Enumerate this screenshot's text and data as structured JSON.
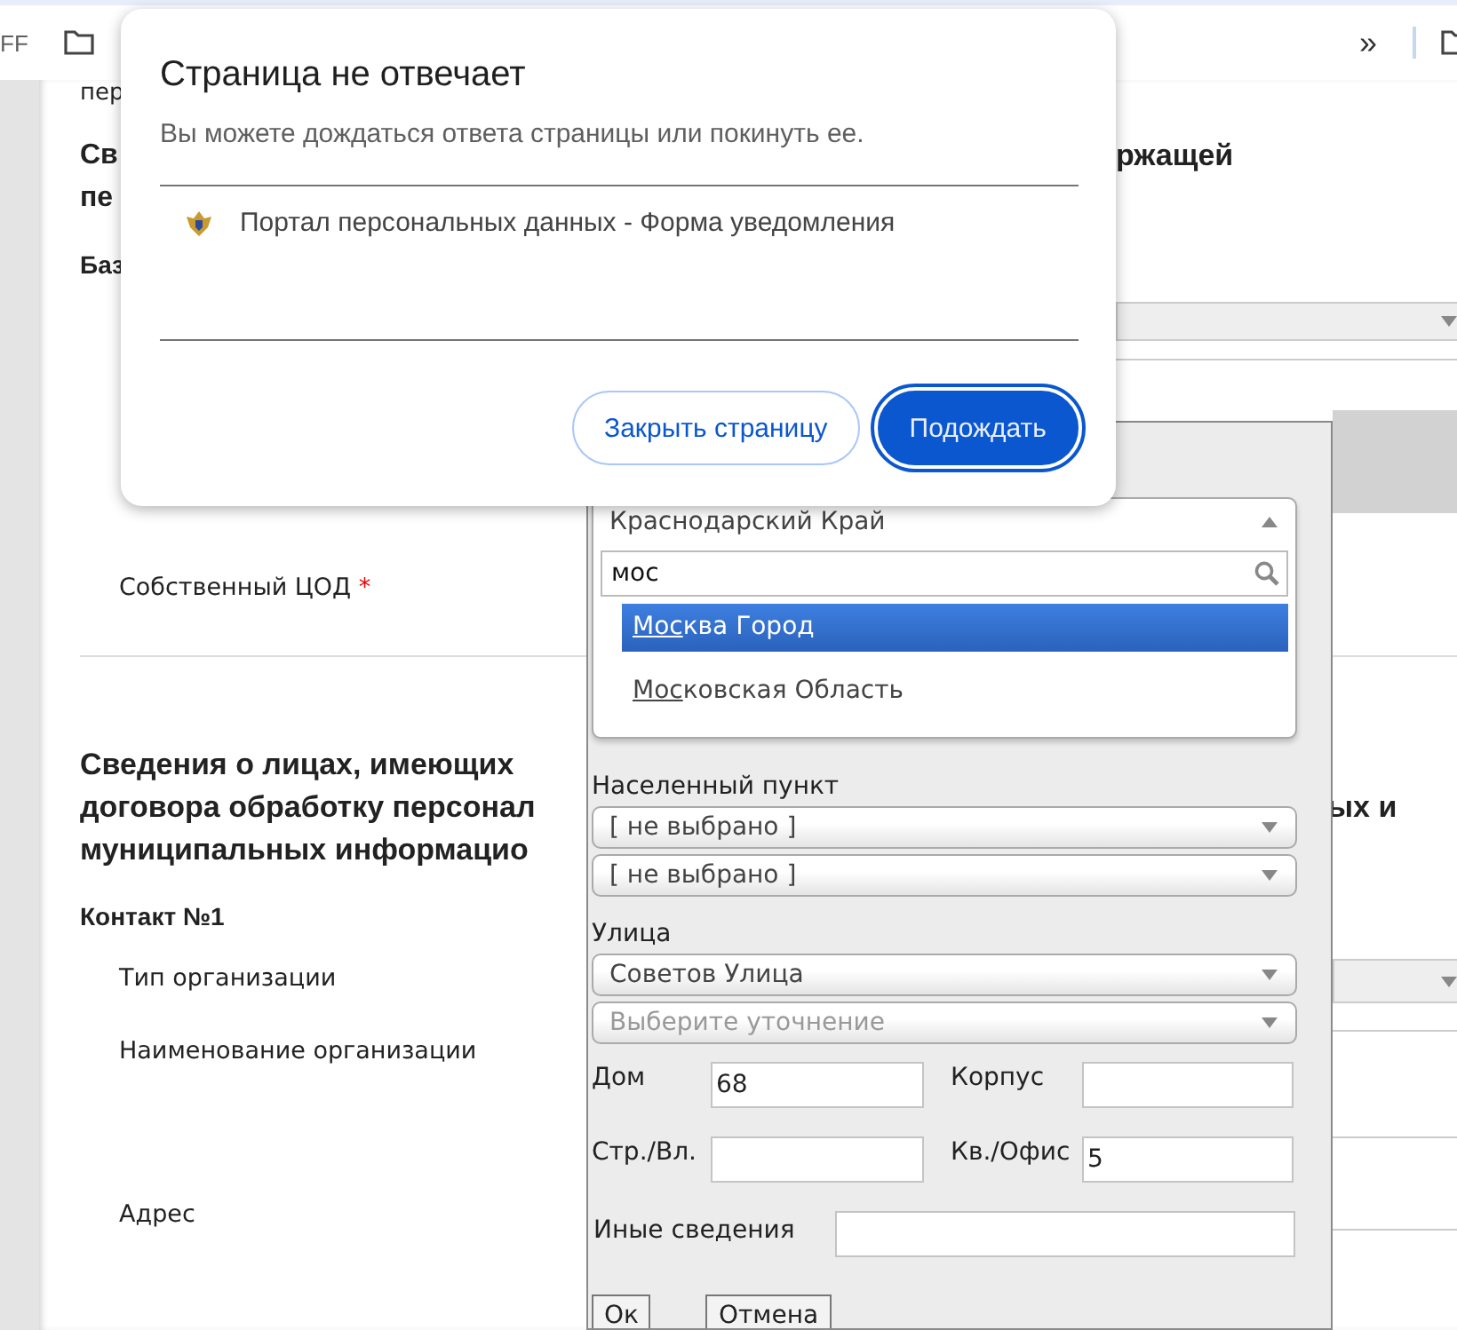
{
  "bookmarks_bar": {
    "items": [
      {
        "label": "FF"
      }
    ],
    "overflow": "»"
  },
  "page": {
    "top_fragment": "пер",
    "heading_1": [
      {
        "left": "Св",
        "right": "ржащей"
      },
      {
        "left": "пе"
      }
    ],
    "subheading": "Баз",
    "own_dc": {
      "label": "Собственный ЦОД",
      "required_mark": "*"
    },
    "heading_2": [
      {
        "left": "Сведения о лицах, имеющих"
      },
      {
        "left": "договора обработку персонал",
        "right": "ых и"
      },
      {
        "left": "муниципальных информацио"
      }
    ],
    "contact": {
      "title": "Контакт №1",
      "fields": [
        {
          "label": "Тип организации",
          "kind": "select"
        },
        {
          "label": "Наименование организации",
          "kind": "text"
        },
        {
          "label": "Адрес",
          "kind": "address"
        }
      ]
    }
  },
  "address_dialog": {
    "region": {
      "value": "Краснодарский Край",
      "expanded": true,
      "search": "мос",
      "options": [
        {
          "label": "Москва Город",
          "selected": true
        },
        {
          "label": "Московская Область",
          "selected": false
        }
      ]
    },
    "locality": {
      "label": "Населенный пункт",
      "selects": [
        {
          "value": "[ не выбрано ]"
        },
        {
          "value": "[ не выбрано ]"
        }
      ]
    },
    "street": {
      "label": "Улица",
      "selects": [
        {
          "value": "Советов Улица"
        },
        {
          "placeholder": "Выберите уточнение"
        }
      ]
    },
    "fields": [
      {
        "label": "Дом",
        "value": "68"
      },
      {
        "label": "Корпус"
      },
      {
        "label": "Стр./Вл."
      },
      {
        "label": "Кв./Офис",
        "value": "5"
      }
    ],
    "other": {
      "label": "Иные сведения"
    },
    "buttons": [
      "Ок",
      "Отмена"
    ]
  },
  "hang_dialog": {
    "title": "Страница не отвечает",
    "message": "Вы можете дождаться ответа страницы или покинуть ее.",
    "pages": [
      {
        "title": "Портал персональных данных - Форма уведомления"
      }
    ],
    "buttons": [
      {
        "label": "Закрыть страницу",
        "kind": "secondary",
        "focused": false
      },
      {
        "label": "Подождать",
        "kind": "primary",
        "focused": true
      }
    ]
  }
}
